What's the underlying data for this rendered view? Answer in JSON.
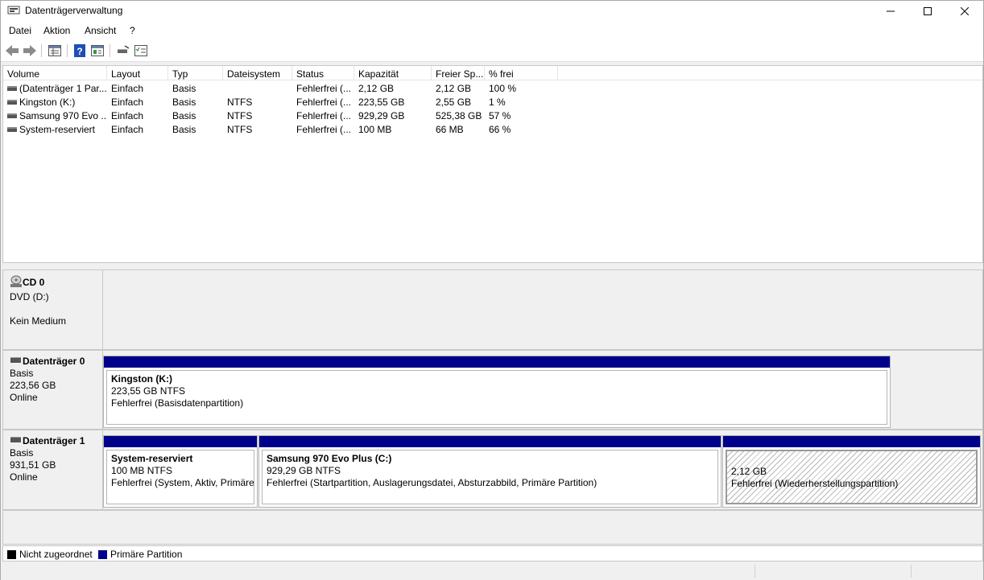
{
  "window": {
    "title": "Datenträgerverwaltung"
  },
  "menu": [
    "Datei",
    "Aktion",
    "Ansicht",
    "?"
  ],
  "toolbar": {
    "icons": [
      "back-icon",
      "forward-icon",
      "list-view-icon",
      "help-icon",
      "properties-icon",
      "connect-icon",
      "checklist-icon"
    ]
  },
  "volumes": {
    "columns": [
      "Volume",
      "Layout",
      "Typ",
      "Dateisystem",
      "Status",
      "Kapazität",
      "Freier Sp...",
      "% frei"
    ],
    "rows": [
      {
        "volume": "(Datenträger 1 Par...",
        "layout": "Einfach",
        "typ": "Basis",
        "fs": "",
        "status": "Fehlerfrei (...",
        "capacity": "2,12 GB",
        "free": "2,12 GB",
        "pct": "100 %"
      },
      {
        "volume": "Kingston (K:)",
        "layout": "Einfach",
        "typ": "Basis",
        "fs": "NTFS",
        "status": "Fehlerfrei (...",
        "capacity": "223,55 GB",
        "free": "2,55 GB",
        "pct": "1 %"
      },
      {
        "volume": "Samsung 970 Evo ...",
        "layout": "Einfach",
        "typ": "Basis",
        "fs": "NTFS",
        "status": "Fehlerfrei (...",
        "capacity": "929,29 GB",
        "free": "525,38 GB",
        "pct": "57 %"
      },
      {
        "volume": "System-reserviert",
        "layout": "Einfach",
        "typ": "Basis",
        "fs": "NTFS",
        "status": "Fehlerfrei (...",
        "capacity": "100 MB",
        "free": "66 MB",
        "pct": "66 %"
      }
    ]
  },
  "disks": {
    "cd0": {
      "name": "CD 0",
      "type": "DVD (D:)",
      "state": "Kein Medium"
    },
    "disk0": {
      "name": "Datenträger 0",
      "kind": "Basis",
      "size": "223,56 GB",
      "state": "Online",
      "partitions": [
        {
          "name": "Kingston  (K:)",
          "size": "223,55 GB NTFS",
          "status": "Fehlerfrei (Basisdatenpartition)"
        }
      ]
    },
    "disk1": {
      "name": "Datenträger 1",
      "kind": "Basis",
      "size": "931,51 GB",
      "state": "Online",
      "partitions": [
        {
          "name": "System-reserviert",
          "size": "100 MB NTFS",
          "status": "Fehlerfrei (System, Aktiv, Primäre"
        },
        {
          "name": "Samsung 970 Evo Plus  (C:)",
          "size": "929,29 GB NTFS",
          "status": "Fehlerfrei (Startpartition, Auslagerungsdatei, Absturzabbild, Primäre Partition)"
        },
        {
          "name": "",
          "size": "2,12 GB",
          "status": "Fehlerfrei (Wiederherstellungspartition)"
        }
      ]
    }
  },
  "legend": [
    {
      "label": "Nicht zugeordnet",
      "color": "#000000"
    },
    {
      "label": "Primäre Partition",
      "color": "#00008b"
    }
  ],
  "colors": {
    "primary_partition_bar": "#00008b",
    "unallocated": "#000000"
  }
}
